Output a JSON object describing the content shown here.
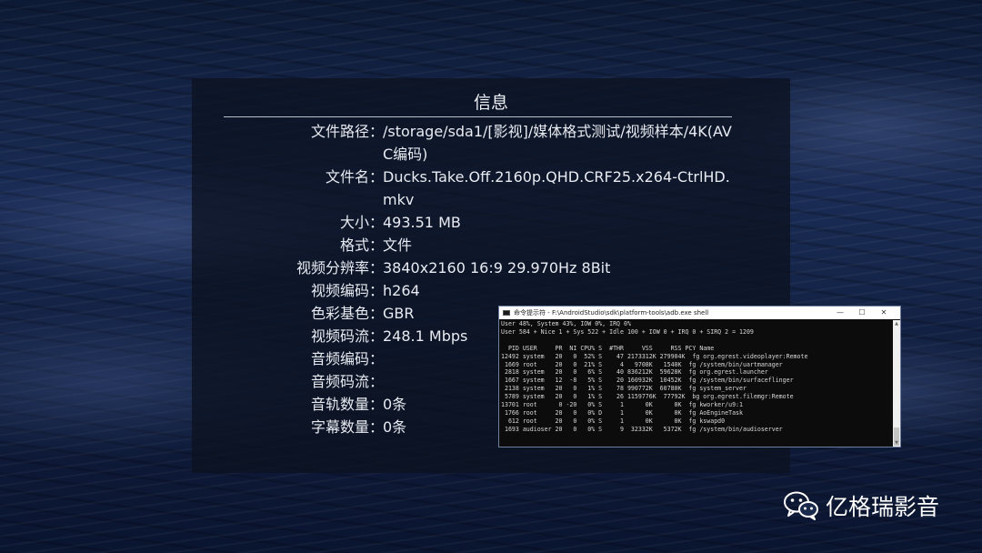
{
  "info_dialog": {
    "title": "信息",
    "rows": [
      {
        "label": "文件路径",
        "value": "/storage/sda1/[影视]/媒体格式测试/视频样本/4K(AVC编码)"
      },
      {
        "label": "文件名",
        "value": "Ducks.Take.Off.2160p.QHD.CRF25.x264-CtrlHD.mkv"
      },
      {
        "label": "大小",
        "value": "493.51 MB"
      },
      {
        "label": "格式",
        "value": "文件"
      },
      {
        "label": "视频分辨率",
        "value": "3840x2160 16:9 29.970Hz 8Bit"
      },
      {
        "label": "视频编码",
        "value": "h264"
      },
      {
        "label": "色彩基色",
        "value": "GBR"
      },
      {
        "label": "视频码流",
        "value": "248.1 Mbps"
      },
      {
        "label": "音频编码",
        "value": ""
      },
      {
        "label": "音频码流",
        "value": ""
      },
      {
        "label": "音轨数量",
        "value": "0条"
      },
      {
        "label": "字幕数量",
        "value": "0条"
      }
    ],
    "separator": "："
  },
  "terminal": {
    "title": "命令提示符 - F:\\AndroidStudio\\sdk\\platform-tools\\adb.exe  shell",
    "window_buttons": [
      "—",
      "☐",
      "✕"
    ],
    "lines": [
      "User 48%, System 43%, IOW 0%, IRQ 0%",
      "User 584 + Nice 1 + Sys 522 + Idle 100 + IOW 0 + IRQ 0 + SIRQ 2 = 1209",
      "",
      "  PID USER     PR  NI CPU% S  #THR     VSS     RSS PCY Name",
      "12492 system   20   0  52% S    47 2173312K 279904K  fg org.egrest.videoplayer:Remote",
      " 1669 root     20   0  21% S     4   9708K   1540K  fg /system/bin/uartmanager",
      " 2818 system   20   0   6% S    40 836212K  59628K  fg org.egrest.launcher",
      " 1667 system   12  -8   5% S    20 160932K  10452K  fg /system/bin/surfaceflinger",
      " 2138 system   20   0   1% S    78 990772K  60780K  fg system_server",
      " 5789 system   20   0   1% S    26 1159776K  77792K  bg org.egrest.filemgr:Remote",
      "13701 root      0 -20   0% S     1      0K      0K  fg kworker/u9:1",
      " 1766 root     20   0   0% D     1      0K      0K  fg AoEngineTask",
      "  612 root     20   0   0% S     1      0K      0K  fg kswapd0",
      " 1693 audioser 20   0   0% S     9  32332K   5372K  fg /system/bin/audioserver"
    ]
  },
  "watermark": {
    "text": "亿格瑞影音",
    "icon": "wechat-icon"
  }
}
